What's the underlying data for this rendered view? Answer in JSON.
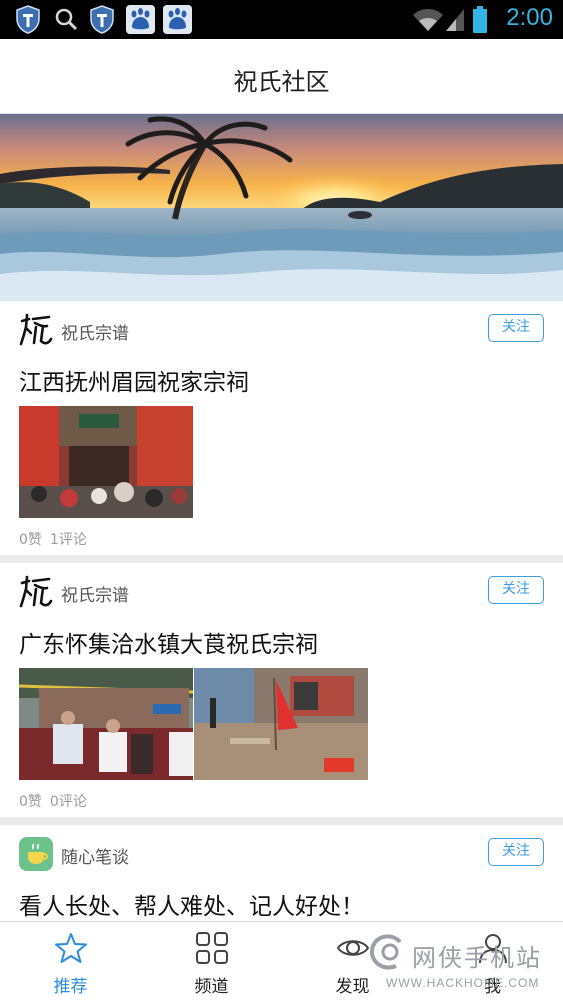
{
  "status_bar": {
    "time": "2:00",
    "icons": [
      "shield-icon",
      "search-icon",
      "shield-icon",
      "baidu-icon",
      "baidu-icon",
      "wifi-icon",
      "signal-icon",
      "battery-icon"
    ]
  },
  "header": {
    "title": "祝氏社区"
  },
  "banner": {
    "image": "sunset-beach-palm",
    "dots": 1,
    "active_dot": 1
  },
  "feed": [
    {
      "source": "祝氏宗谱",
      "follow_label": "关注",
      "title": "江西抚州眉园祝家宗祠",
      "images": [
        "ancestral-hall-gate-crowd"
      ],
      "likes": "0赞",
      "comments": "1评论"
    },
    {
      "source": "祝氏宗谱",
      "follow_label": "关注",
      "title": "广东怀集洽水镇大莨祝氏宗祠",
      "images": [
        "people-at-ceremony",
        "courtyard-red-flag"
      ],
      "likes": "0赞",
      "comments": "0评论"
    },
    {
      "source": "随心笔谈",
      "follow_label": "关注",
      "title": "看人长处、帮人难处、记人好处！"
    }
  ],
  "bottom_nav": [
    {
      "label": "推荐",
      "icon": "star-icon",
      "active": true
    },
    {
      "label": "频道",
      "icon": "grid-icon",
      "active": false
    },
    {
      "label": "发现",
      "icon": "eye-icon",
      "active": false
    },
    {
      "label": "我",
      "icon": "user-icon",
      "active": false
    }
  ],
  "watermark": {
    "text": "网侠手机站",
    "url": "WWW.HACKHOME.COM"
  },
  "colors": {
    "accent": "#2a8de0",
    "follow_border": "#3b9ee0",
    "status_time": "#33b5e5"
  }
}
